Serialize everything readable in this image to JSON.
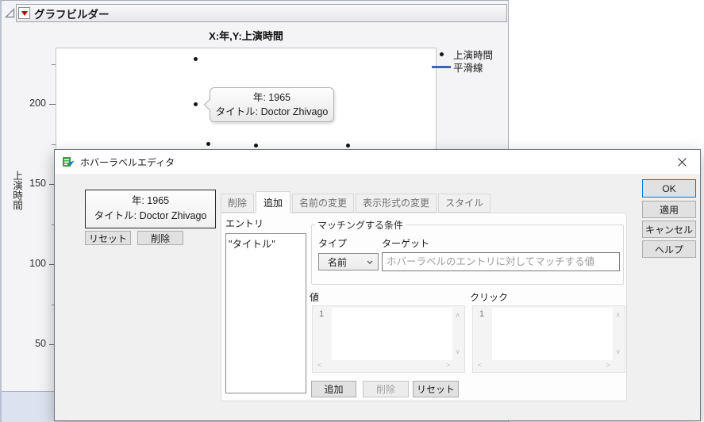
{
  "graph_builder": {
    "title": "グラフビルダー",
    "chart_title": "X:年,Y:上演時間",
    "y_axis_label": "上演時間",
    "tooltip": {
      "line1": "年: 1965",
      "line2": "タイトル: Doctor Zhivago"
    },
    "legend": [
      {
        "type": "point",
        "label": "上演時間",
        "color": "#141414"
      },
      {
        "type": "line",
        "label": "平滑線",
        "color": "#3a67ac"
      }
    ]
  },
  "chart_data": {
    "type": "scatter",
    "title": "X:年,Y:上演時間",
    "xlabel": "年",
    "ylabel": "上演時間",
    "xlim": [
      1930,
      2025
    ],
    "ylim": [
      25,
      235
    ],
    "y_major_ticks": [
      50,
      100,
      150,
      200
    ],
    "y_minor_ticks": [
      75,
      125,
      175,
      225
    ],
    "grid": false,
    "legend_position": "right",
    "series": [
      {
        "name": "上演時間",
        "points": [
          {
            "year": 1965,
            "minutes": 228
          },
          {
            "year": 1965,
            "minutes": 200,
            "label": "Doctor Zhivago",
            "tooltip": true
          },
          {
            "year": 1968,
            "minutes": 175
          },
          {
            "year": 1980,
            "minutes": 174
          },
          {
            "year": 2003,
            "minutes": 174
          }
        ]
      },
      {
        "name": "平滑線",
        "note_visible_points": "line hidden behind dialog",
        "points": []
      }
    ]
  },
  "dialog": {
    "title": "ホバーラベルエディタ",
    "preview": {
      "line1": "年: 1965",
      "line2": "タイトル: Doctor Zhivago"
    },
    "preview_buttons": {
      "reset": "リセット",
      "delete": "削除"
    },
    "tabs": [
      {
        "label": "削除",
        "active": false
      },
      {
        "label": "追加",
        "active": true
      },
      {
        "label": "名前の変更",
        "active": false
      },
      {
        "label": "表示形式の変更",
        "active": false
      },
      {
        "label": "スタイル",
        "active": false
      }
    ],
    "entry": {
      "label": "エントリ",
      "items": [
        "\"タイトル\""
      ]
    },
    "matching": {
      "group_label": "マッチングする条件",
      "type_label": "タイプ",
      "type_value": "名前",
      "target_label": "ターゲット",
      "target_value": "",
      "target_placeholder": "ホバーラベルのエントリに対してマッチする値"
    },
    "value_editor": {
      "label": "値",
      "line_number": "1",
      "content": ""
    },
    "click_editor": {
      "label": "クリック",
      "line_number": "1",
      "content": ""
    },
    "action_buttons": {
      "add": "追加",
      "delete": "削除",
      "reset": "リセット"
    },
    "action_buttons_state": {
      "add_enabled": true,
      "delete_enabled": false,
      "reset_enabled": true
    },
    "side_buttons": {
      "ok": "OK",
      "apply": "適用",
      "cancel": "キャンセル",
      "help": "ヘルプ"
    }
  },
  "icons": {
    "scroll_up": "∧",
    "scroll_down": "∨",
    "scroll_left": "<",
    "scroll_right": ">"
  },
  "colors": {
    "accent": "#0078d7",
    "point": "#141414",
    "smoother_line": "#3a67ac",
    "bottom_band": "#dce3f0"
  }
}
